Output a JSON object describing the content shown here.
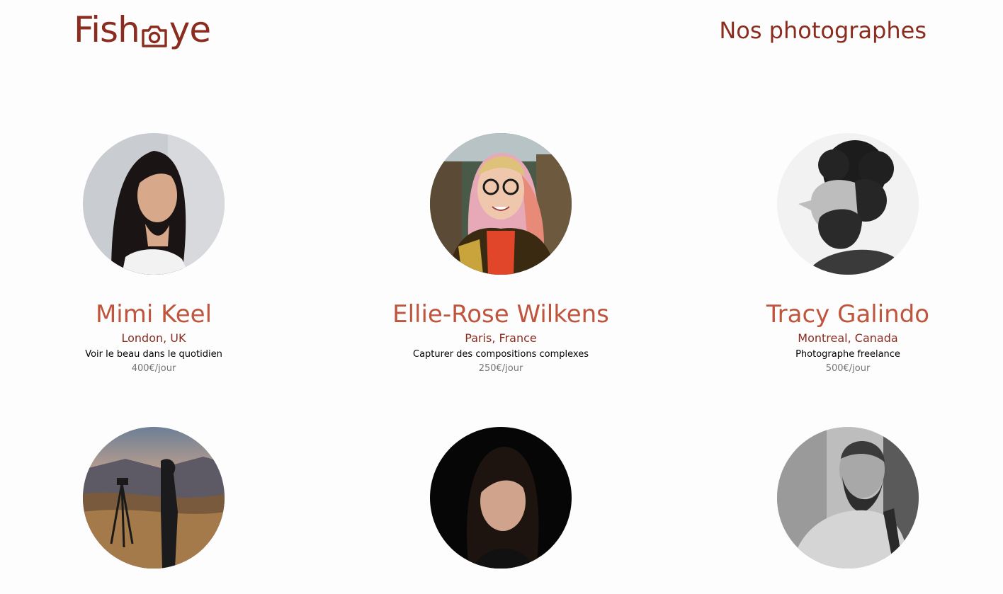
{
  "header": {
    "logo_text_left": "Fish",
    "logo_text_right": "ye",
    "logo_icon": "camera-icon",
    "title": "Nos photographes"
  },
  "colors": {
    "primary": "#8b2c1f",
    "name": "#c0553d",
    "tagline": "#000000",
    "price": "#757575",
    "background": "#fdfdfd"
  },
  "photographers": [
    {
      "name": "Mimi Keel",
      "location": "London, UK",
      "tagline": "Voir le beau dans le quotidien",
      "price": "400€/jour"
    },
    {
      "name": "Ellie-Rose Wilkens",
      "location": "Paris, France",
      "tagline": "Capturer des compositions complexes",
      "price": "250€/jour"
    },
    {
      "name": "Tracy Galindo",
      "location": "Montreal, Canada",
      "tagline": "Photographe freelance",
      "price": "500€/jour"
    },
    {
      "name": "",
      "location": "",
      "tagline": "",
      "price": ""
    },
    {
      "name": "",
      "location": "",
      "tagline": "",
      "price": ""
    },
    {
      "name": "",
      "location": "",
      "tagline": "",
      "price": ""
    }
  ]
}
